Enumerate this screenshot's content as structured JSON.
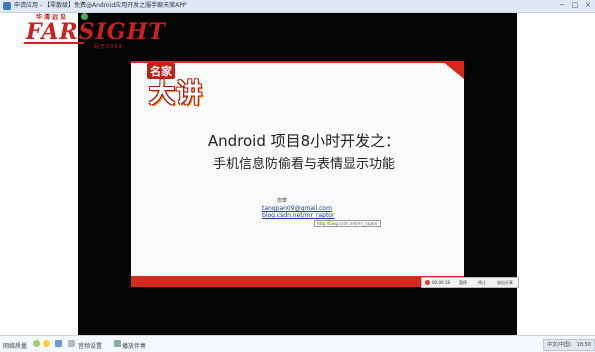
{
  "window": {
    "title": "申请应用 - 【零散级】免费@Android应用开发之服手聊天案APP",
    "minimize": "−",
    "maximize": "□",
    "close": "×"
  },
  "logo": {
    "chinese": "华清远见",
    "brand": "FARSIGHT",
    "tagline": "始于2004"
  },
  "slide": {
    "badge_small": "名家",
    "badge_big": "大讲",
    "title_line1": "Android 项目8小时开发之：",
    "title_line2": "手机信息防偷看与表情显示功能",
    "author": "唐攀",
    "email": "tangpan09@gmail.com",
    "blog": "blog.csdn.net/mr_raptor",
    "tooltip": "http://blog.csdn.net/mr_raptor"
  },
  "control_bar": {
    "time": "00:00:18",
    "btn1": "暂停",
    "btn2": "停止",
    "btn3": "退出分享"
  },
  "statusbar": {
    "item1": "网络质量",
    "item2": "音频设置",
    "item3": "播放伴奏",
    "tray_ime": "中文(中国)",
    "tray_time": "18:50"
  },
  "colors": {
    "accent_red": "#d8261c",
    "link_blue": "#1a3c9a"
  }
}
